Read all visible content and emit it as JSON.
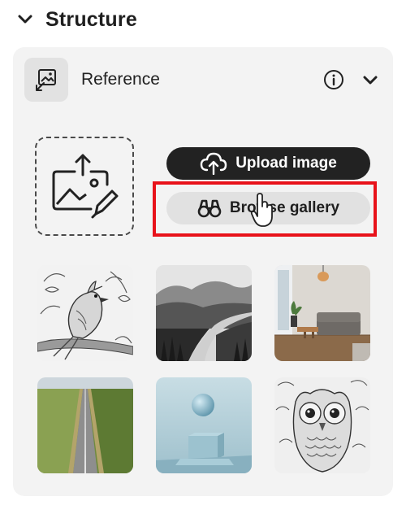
{
  "section": {
    "title": "Structure",
    "icon": "chevron-down-icon"
  },
  "reference": {
    "label": "Reference",
    "icon": "image-reference-icon",
    "info_icon": "info-icon",
    "expand_icon": "chevron-down-icon"
  },
  "upload": {
    "drop_zone_icon": "image-upload-edit-icon",
    "upload_label": "Upload image",
    "upload_icon": "cloud-upload-icon",
    "browse_label": "Browse gallery",
    "browse_icon": "binoculars-icon"
  },
  "gallery": {
    "items": [
      {
        "subject": "bird-sketch"
      },
      {
        "subject": "misty-river-landscape"
      },
      {
        "subject": "living-room-interior"
      },
      {
        "subject": "straight-road-fields"
      },
      {
        "subject": "sphere-on-cube"
      },
      {
        "subject": "owl-sketch"
      }
    ]
  },
  "colors": {
    "highlight": "#e8121a",
    "upload_button": "#222222",
    "panel": "#f3f3f3"
  }
}
